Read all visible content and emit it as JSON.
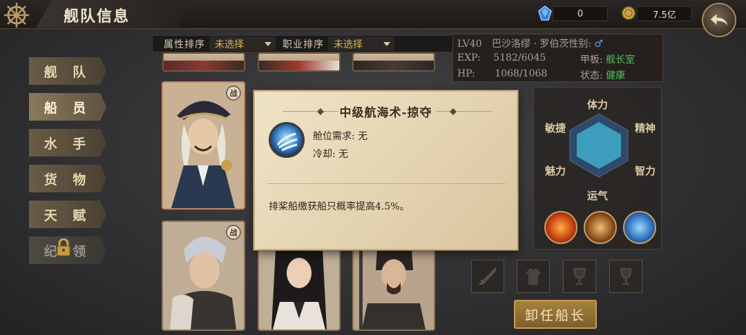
{
  "header": {
    "title": "舰队信息"
  },
  "currency": [
    {
      "icon": "blue-gem-icon",
      "value": "0"
    },
    {
      "icon": "gold-coin-icon",
      "value": "7.5亿"
    }
  ],
  "nav": {
    "items": [
      {
        "label": "舰 队",
        "state": "normal"
      },
      {
        "label": "船 员",
        "state": "active"
      },
      {
        "label": "水 手",
        "state": "normal"
      },
      {
        "label": "货 物",
        "state": "normal"
      },
      {
        "label": "天 赋",
        "state": "normal"
      },
      {
        "label": "纪 领",
        "state": "locked"
      }
    ]
  },
  "sort": {
    "attr_label": "属性排序",
    "attr_value": "未选择",
    "job_label": "职业排序",
    "job_value": "未选择"
  },
  "cards": {
    "badge": "战"
  },
  "captain": {
    "level": "LV40",
    "name": "巴沙洛缪 · 罗伯茨",
    "gender_label": "性别:",
    "gender_symbol": "♂",
    "exp_label": "EXP:",
    "exp_value": "5182/6045",
    "hp_label": "HP:",
    "hp_value": "1068/1068",
    "deck_label": "甲板:",
    "deck_value": "舰长室",
    "status_label": "状态:",
    "status_value": "健康"
  },
  "stats": {
    "labels": [
      "体力",
      "精神",
      "智力",
      "运气",
      "魅力",
      "敏捷"
    ]
  },
  "skills": [
    "fire-skill-icon",
    "sail-skill-icon",
    "blue-claw-skill-icon"
  ],
  "equipment": [
    "sword-slot-icon",
    "armor-slot-icon",
    "cup-slot-icon",
    "goblet-slot-icon"
  ],
  "dismiss_label": "卸任船长",
  "tooltip": {
    "title": "中级航海术-掠夺",
    "cabin_label": "舱位需求:",
    "cabin_value": "无",
    "cooldown_label": "冷却:",
    "cooldown_value": "无",
    "description": "排桨船缴获船只概率提高4.5%。"
  },
  "colors": {
    "accent_gold": "#d7b25a",
    "status_green": "#4fc05a",
    "gender_blue": "#5aa8e8"
  }
}
